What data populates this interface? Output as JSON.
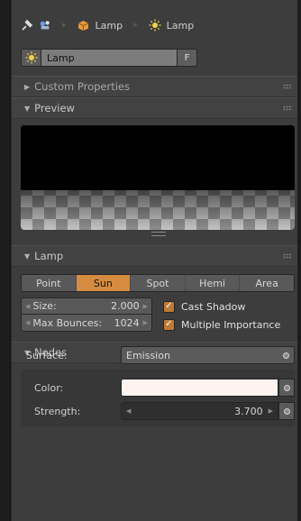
{
  "breadcrumb": {
    "items": [
      {
        "label": "Lamp",
        "icon": "lamp-object-icon"
      },
      {
        "label": "Lamp",
        "icon": "sun-lamp-icon"
      }
    ]
  },
  "datablock": {
    "name": "Lamp",
    "fake_user_label": "F"
  },
  "panels": {
    "custom_properties": "Custom Properties",
    "preview": "Preview",
    "lamp": "Lamp",
    "nodes": "Nodes"
  },
  "lamp_types": [
    {
      "label": "Point",
      "active": false
    },
    {
      "label": "Sun",
      "active": true
    },
    {
      "label": "Spot",
      "active": false
    },
    {
      "label": "Hemi",
      "active": false
    },
    {
      "label": "Area",
      "active": false
    }
  ],
  "lamp_props": {
    "size_label": "Size:",
    "size_value": "2.000",
    "max_bounces_label": "Max Bounces:",
    "max_bounces_value": "1024",
    "cast_shadow_label": "Cast Shadow",
    "cast_shadow_checked": true,
    "multiple_importance_label": "Multiple Importance",
    "multiple_importance_checked": true
  },
  "nodes": {
    "surface_label": "Surface:",
    "surface_value": "Emission",
    "color_label": "Color:",
    "color_value": "#fff3f0",
    "strength_label": "Strength:",
    "strength_value": "3.700"
  },
  "colors": {
    "accent": "#d58c40",
    "panel_bg": "#3d3d3d",
    "field_bg": "#595959"
  }
}
